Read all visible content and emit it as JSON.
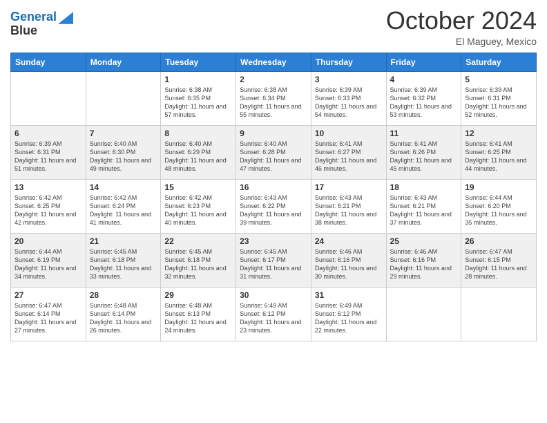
{
  "header": {
    "logo_line1": "General",
    "logo_line2": "Blue",
    "month_year": "October 2024",
    "location": "El Maguey, Mexico"
  },
  "days_of_week": [
    "Sunday",
    "Monday",
    "Tuesday",
    "Wednesday",
    "Thursday",
    "Friday",
    "Saturday"
  ],
  "weeks": [
    [
      {
        "day": "",
        "info": ""
      },
      {
        "day": "",
        "info": ""
      },
      {
        "day": "1",
        "sunrise": "Sunrise: 6:38 AM",
        "sunset": "Sunset: 6:35 PM",
        "daylight": "Daylight: 11 hours and 57 minutes."
      },
      {
        "day": "2",
        "sunrise": "Sunrise: 6:38 AM",
        "sunset": "Sunset: 6:34 PM",
        "daylight": "Daylight: 11 hours and 55 minutes."
      },
      {
        "day": "3",
        "sunrise": "Sunrise: 6:39 AM",
        "sunset": "Sunset: 6:33 PM",
        "daylight": "Daylight: 11 hours and 54 minutes."
      },
      {
        "day": "4",
        "sunrise": "Sunrise: 6:39 AM",
        "sunset": "Sunset: 6:32 PM",
        "daylight": "Daylight: 11 hours and 53 minutes."
      },
      {
        "day": "5",
        "sunrise": "Sunrise: 6:39 AM",
        "sunset": "Sunset: 6:31 PM",
        "daylight": "Daylight: 11 hours and 52 minutes."
      }
    ],
    [
      {
        "day": "6",
        "sunrise": "Sunrise: 6:39 AM",
        "sunset": "Sunset: 6:31 PM",
        "daylight": "Daylight: 11 hours and 51 minutes."
      },
      {
        "day": "7",
        "sunrise": "Sunrise: 6:40 AM",
        "sunset": "Sunset: 6:30 PM",
        "daylight": "Daylight: 11 hours and 49 minutes."
      },
      {
        "day": "8",
        "sunrise": "Sunrise: 6:40 AM",
        "sunset": "Sunset: 6:29 PM",
        "daylight": "Daylight: 11 hours and 48 minutes."
      },
      {
        "day": "9",
        "sunrise": "Sunrise: 6:40 AM",
        "sunset": "Sunset: 6:28 PM",
        "daylight": "Daylight: 11 hours and 47 minutes."
      },
      {
        "day": "10",
        "sunrise": "Sunrise: 6:41 AM",
        "sunset": "Sunset: 6:27 PM",
        "daylight": "Daylight: 11 hours and 46 minutes."
      },
      {
        "day": "11",
        "sunrise": "Sunrise: 6:41 AM",
        "sunset": "Sunset: 6:26 PM",
        "daylight": "Daylight: 11 hours and 45 minutes."
      },
      {
        "day": "12",
        "sunrise": "Sunrise: 6:41 AM",
        "sunset": "Sunset: 6:25 PM",
        "daylight": "Daylight: 11 hours and 44 minutes."
      }
    ],
    [
      {
        "day": "13",
        "sunrise": "Sunrise: 6:42 AM",
        "sunset": "Sunset: 6:25 PM",
        "daylight": "Daylight: 11 hours and 42 minutes."
      },
      {
        "day": "14",
        "sunrise": "Sunrise: 6:42 AM",
        "sunset": "Sunset: 6:24 PM",
        "daylight": "Daylight: 11 hours and 41 minutes."
      },
      {
        "day": "15",
        "sunrise": "Sunrise: 6:42 AM",
        "sunset": "Sunset: 6:23 PM",
        "daylight": "Daylight: 11 hours and 40 minutes."
      },
      {
        "day": "16",
        "sunrise": "Sunrise: 6:43 AM",
        "sunset": "Sunset: 6:22 PM",
        "daylight": "Daylight: 11 hours and 39 minutes."
      },
      {
        "day": "17",
        "sunrise": "Sunrise: 6:43 AM",
        "sunset": "Sunset: 6:21 PM",
        "daylight": "Daylight: 11 hours and 38 minutes."
      },
      {
        "day": "18",
        "sunrise": "Sunrise: 6:43 AM",
        "sunset": "Sunset: 6:21 PM",
        "daylight": "Daylight: 11 hours and 37 minutes."
      },
      {
        "day": "19",
        "sunrise": "Sunrise: 6:44 AM",
        "sunset": "Sunset: 6:20 PM",
        "daylight": "Daylight: 11 hours and 35 minutes."
      }
    ],
    [
      {
        "day": "20",
        "sunrise": "Sunrise: 6:44 AM",
        "sunset": "Sunset: 6:19 PM",
        "daylight": "Daylight: 11 hours and 34 minutes."
      },
      {
        "day": "21",
        "sunrise": "Sunrise: 6:45 AM",
        "sunset": "Sunset: 6:18 PM",
        "daylight": "Daylight: 11 hours and 33 minutes."
      },
      {
        "day": "22",
        "sunrise": "Sunrise: 6:45 AM",
        "sunset": "Sunset: 6:18 PM",
        "daylight": "Daylight: 11 hours and 32 minutes."
      },
      {
        "day": "23",
        "sunrise": "Sunrise: 6:45 AM",
        "sunset": "Sunset: 6:17 PM",
        "daylight": "Daylight: 11 hours and 31 minutes."
      },
      {
        "day": "24",
        "sunrise": "Sunrise: 6:46 AM",
        "sunset": "Sunset: 6:16 PM",
        "daylight": "Daylight: 11 hours and 30 minutes."
      },
      {
        "day": "25",
        "sunrise": "Sunrise: 6:46 AM",
        "sunset": "Sunset: 6:16 PM",
        "daylight": "Daylight: 11 hours and 29 minutes."
      },
      {
        "day": "26",
        "sunrise": "Sunrise: 6:47 AM",
        "sunset": "Sunset: 6:15 PM",
        "daylight": "Daylight: 11 hours and 28 minutes."
      }
    ],
    [
      {
        "day": "27",
        "sunrise": "Sunrise: 6:47 AM",
        "sunset": "Sunset: 6:14 PM",
        "daylight": "Daylight: 11 hours and 27 minutes."
      },
      {
        "day": "28",
        "sunrise": "Sunrise: 6:48 AM",
        "sunset": "Sunset: 6:14 PM",
        "daylight": "Daylight: 11 hours and 26 minutes."
      },
      {
        "day": "29",
        "sunrise": "Sunrise: 6:48 AM",
        "sunset": "Sunset: 6:13 PM",
        "daylight": "Daylight: 11 hours and 24 minutes."
      },
      {
        "day": "30",
        "sunrise": "Sunrise: 6:49 AM",
        "sunset": "Sunset: 6:12 PM",
        "daylight": "Daylight: 11 hours and 23 minutes."
      },
      {
        "day": "31",
        "sunrise": "Sunrise: 6:49 AM",
        "sunset": "Sunset: 6:12 PM",
        "daylight": "Daylight: 11 hours and 22 minutes."
      },
      {
        "day": "",
        "info": ""
      },
      {
        "day": "",
        "info": ""
      }
    ]
  ]
}
